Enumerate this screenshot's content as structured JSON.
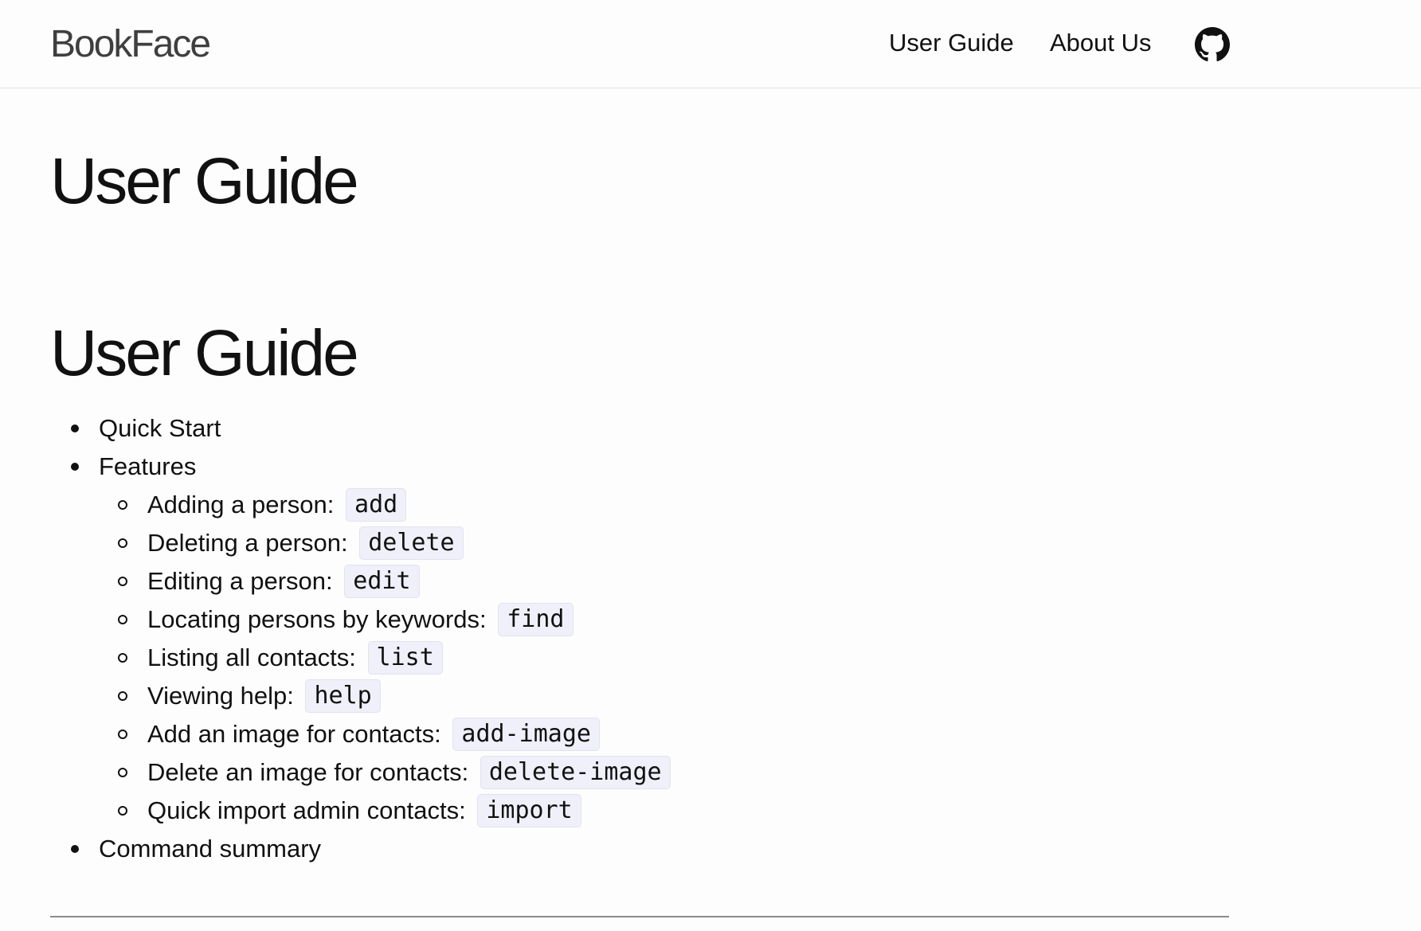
{
  "header": {
    "brand": "BookFace",
    "nav": [
      {
        "label": "User Guide"
      },
      {
        "label": "About Us"
      }
    ],
    "github_icon": "github-icon"
  },
  "page": {
    "title": "User Guide",
    "section_title": "User Guide"
  },
  "toc": {
    "items": [
      {
        "label": "Quick Start"
      },
      {
        "label": "Features"
      },
      {
        "label": "Command summary"
      }
    ],
    "features": [
      {
        "label": "Adding a person:",
        "command": "add"
      },
      {
        "label": "Deleting a person:",
        "command": "delete"
      },
      {
        "label": "Editing a person:",
        "command": "edit"
      },
      {
        "label": "Locating persons by keywords:",
        "command": "find"
      },
      {
        "label": "Listing all contacts:",
        "command": "list"
      },
      {
        "label": "Viewing help:",
        "command": "help"
      },
      {
        "label": "Add an image for contacts:",
        "command": "add-image"
      },
      {
        "label": "Delete an image for contacts:",
        "command": "delete-image"
      },
      {
        "label": "Quick import admin contacts:",
        "command": "import"
      }
    ]
  },
  "colors": {
    "background": "#fdfdfd",
    "text": "#111111",
    "code_background": "#f0f0fa",
    "brand_text": "#3f3f3f",
    "divider": "#8a8a8a"
  }
}
